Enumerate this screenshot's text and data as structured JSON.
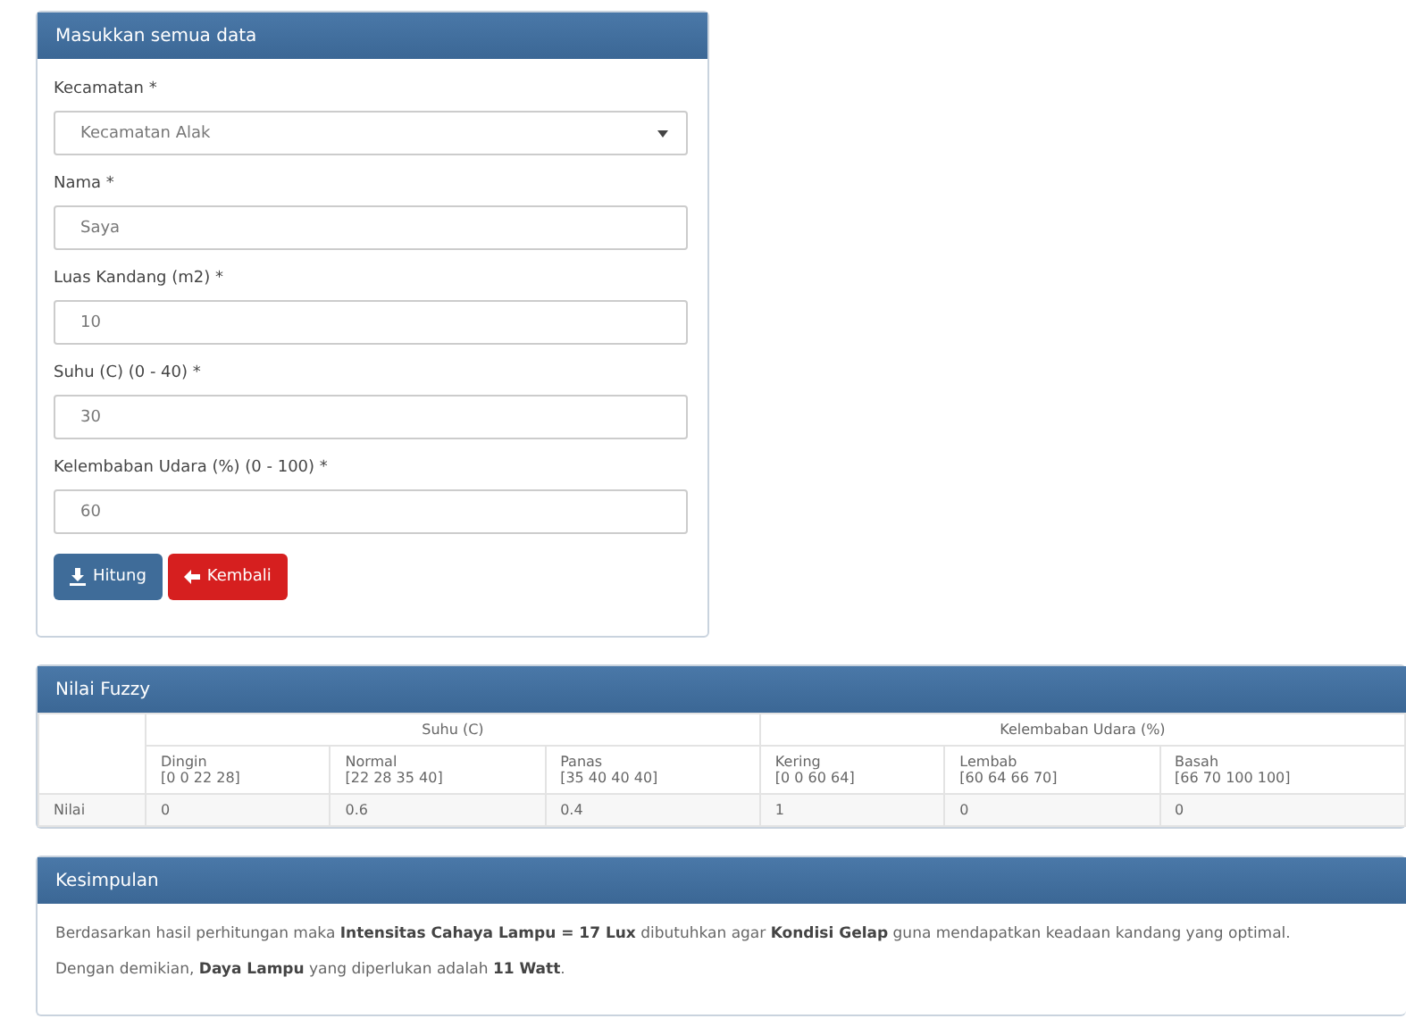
{
  "form_panel": {
    "title": "Masukkan semua data",
    "fields": [
      {
        "kind": "select",
        "label": "Kecamatan *",
        "value": "Kecamatan Alak"
      },
      {
        "kind": "input",
        "label": "Nama *",
        "value": "Saya"
      },
      {
        "kind": "input",
        "label": "Luas Kandang (m2) *",
        "value": "10"
      },
      {
        "kind": "input",
        "label": "Suhu (C) (0 - 40) *",
        "value": "30"
      },
      {
        "kind": "input",
        "label": "Kelembaban Udara (%) (0 - 100) *",
        "value": "60"
      }
    ],
    "buttons": [
      {
        "kind": "primary",
        "label": "Hitung"
      },
      {
        "kind": "danger",
        "label": "Kembali"
      }
    ]
  },
  "fuzzy_panel": {
    "title": "Nilai Fuzzy",
    "groups": [
      "Suhu (C)",
      "Kelembaban Udara (%)"
    ],
    "columns": [
      {
        "name": "Dingin",
        "range": "[0 0 22 28]"
      },
      {
        "name": "Normal",
        "range": "[22 28 35 40]"
      },
      {
        "name": "Panas",
        "range": "[35 40 40 40]"
      },
      {
        "name": "Kering",
        "range": "[0 0 60 64]"
      },
      {
        "name": "Lembab",
        "range": "[60 64 66 70]"
      },
      {
        "name": "Basah",
        "range": "[66 70 100 100]"
      }
    ],
    "row": {
      "label": "Nilai",
      "values": [
        "0",
        "0.6",
        "0.4",
        "1",
        "0",
        "0"
      ]
    }
  },
  "summary_panel": {
    "title": "Kesimpulan",
    "sentences": [
      "Berdasarkan hasil perhitungan maka **Intensitas Cahaya Lampu = 17 Lux** dibutuhkan agar **Kondisi Gelap** guna mendapatkan keadaan kandang yang optimal.",
      "Dengan demikian, **Daya Lampu** yang diperlukan adalah **11 Watt**."
    ]
  }
}
